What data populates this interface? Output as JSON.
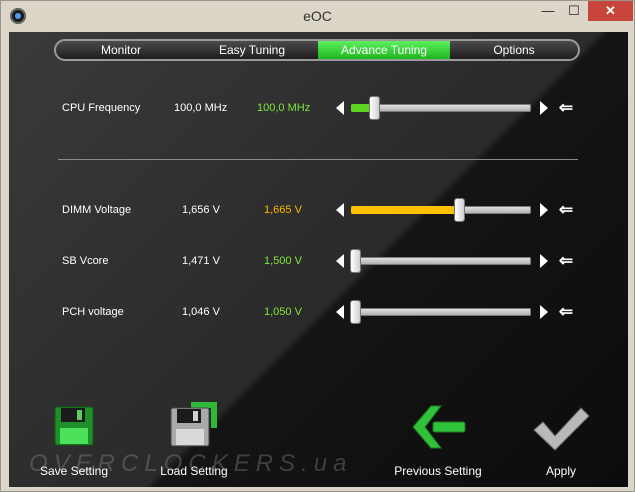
{
  "window": {
    "title": "eOC"
  },
  "titlebar_buttons": {
    "minimize": "—",
    "maximize": "☐",
    "close": "✕"
  },
  "tabs": [
    {
      "label": "Monitor",
      "active": false
    },
    {
      "label": "Easy Tuning",
      "active": false
    },
    {
      "label": "Advance Tuning",
      "active": true
    },
    {
      "label": "Options",
      "active": false
    }
  ],
  "settings": [
    {
      "label": "CPU Frequency",
      "current": "100,0 MHz",
      "target": "100,0 MHz",
      "target_color": "#7ee83a",
      "fill_color": "#5fd321",
      "slider_fraction": 0.11
    },
    {
      "label": "DIMM Voltage",
      "current": "1,656 V",
      "target": "1,665 V",
      "target_color": "#ffb400",
      "fill_color": "#ffc000",
      "slider_fraction": 0.61
    },
    {
      "label": "SB Vcore",
      "current": "1,471 V",
      "target": "1,500 V",
      "target_color": "#7ee83a",
      "fill_color": "",
      "slider_fraction": 0.0
    },
    {
      "label": "PCH voltage",
      "current": "1,046 V",
      "target": "1,050 V",
      "target_color": "#7ee83a",
      "fill_color": "",
      "slider_fraction": 0.0
    }
  ],
  "bottom_buttons": {
    "save": "Save Setting",
    "load": "Load Setting",
    "previous": "Previous Setting",
    "apply": "Apply"
  },
  "watermark": "OVERCLOCKERS.ua",
  "icons": {
    "app": "app-eye-icon",
    "save": "floppy-disk-icon",
    "load": "floppy-load-icon",
    "previous": "back-arrow-icon",
    "apply": "checkmark-icon",
    "reset": "reset-arrow-icon"
  }
}
